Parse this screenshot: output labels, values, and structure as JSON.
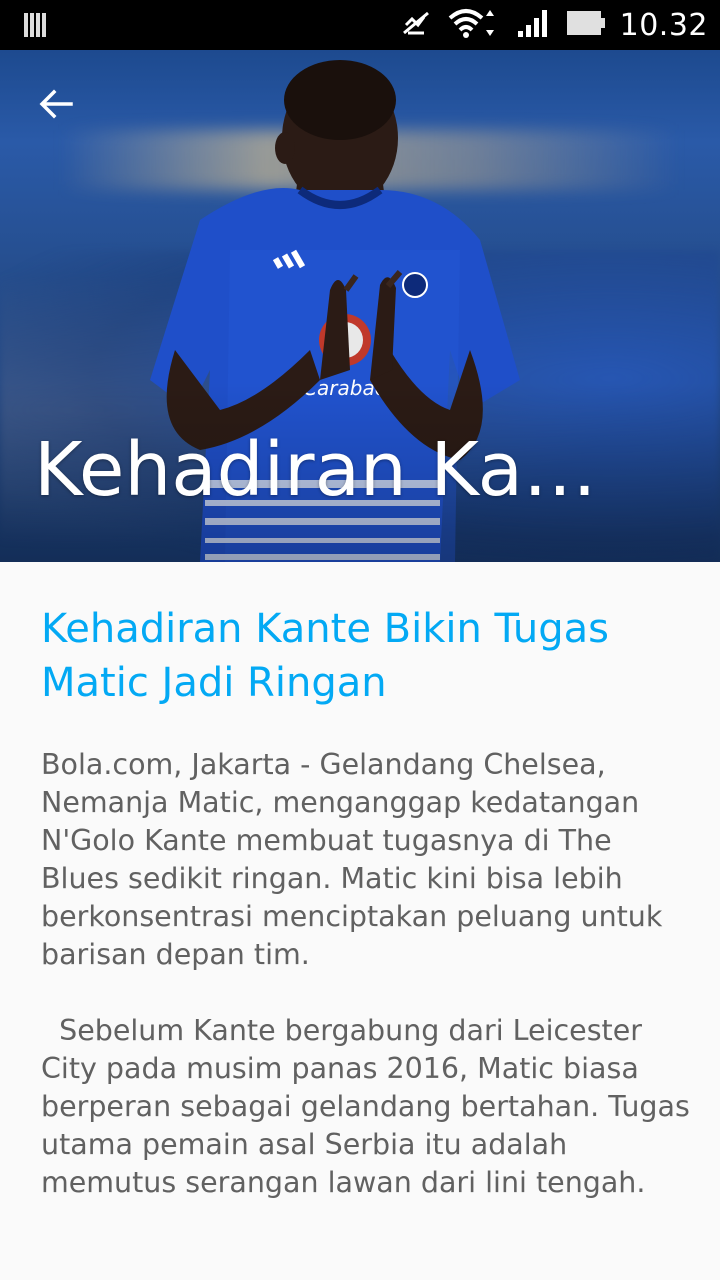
{
  "status_bar": {
    "time": "10.32",
    "icons": [
      "notification-icon",
      "mute-icon",
      "wifi-icon",
      "signal-icon",
      "battery-icon"
    ]
  },
  "toolbar": {
    "back_icon": "arrow-back-icon",
    "collapsed_title": "Kehadiran Ka…"
  },
  "article": {
    "title": "Kehadiran Kante Bikin Tugas Matic Jadi Ringan",
    "body": "Bola.com, Jakarta - Gelandang Chelsea, Nemanja Matic, menganggap kedatangan N'Golo Kante membuat tugasnya di The Blues sedikit ringan. Matic kini bisa lebih berkonsentrasi menciptakan peluang untuk barisan depan tim.\n\n  Sebelum Kante bergabung dari Leicester City pada musim panas 2016, Matic biasa berperan sebagai gelandang bertahan. Tugas utama pemain asal Serbia itu adalah memutus serangan lawan dari lini tengah.",
    "title_color": "#03a9f4",
    "body_color": "#616161"
  },
  "hero_image": {
    "shirt_sponsor": "Carabao"
  }
}
